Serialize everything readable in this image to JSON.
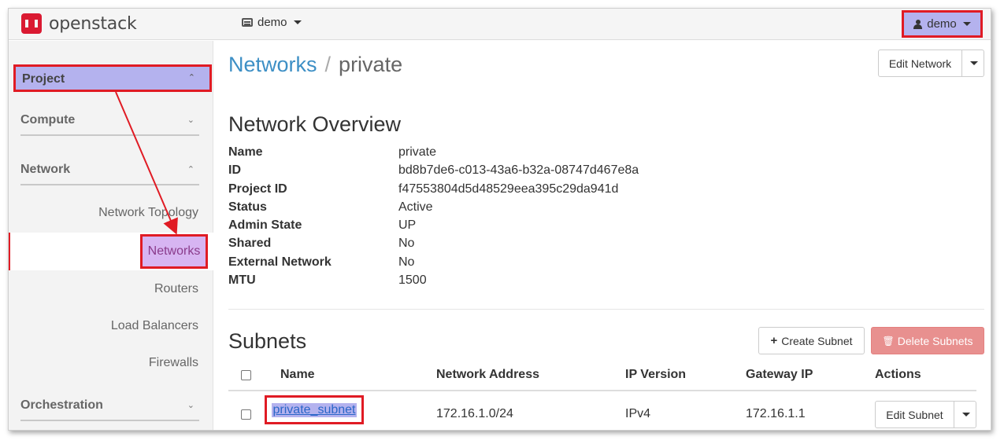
{
  "topbar": {
    "brand": "openstack",
    "project_selector": "demo",
    "user_menu": "demo"
  },
  "sidebar": {
    "project": "Project",
    "compute": "Compute",
    "network": "Network",
    "network_links": [
      "Network Topology",
      "Networks",
      "Routers",
      "Load Balancers",
      "Firewalls"
    ],
    "orchestration": "Orchestration",
    "active_item": "Networks"
  },
  "breadcrumb": {
    "parent": "Networks",
    "separator": "/",
    "current": "private"
  },
  "actions": {
    "edit_network": "Edit Network",
    "create_subnet": "Create Subnet",
    "delete_subnets": "Delete Subnets"
  },
  "overview": {
    "title": "Network Overview",
    "rows": [
      {
        "key": "Name",
        "value": "private"
      },
      {
        "key": "ID",
        "value": "bd8b7de6-c013-43a6-b32a-08747d467e8a"
      },
      {
        "key": "Project ID",
        "value": "f47553804d5d48529eea395c29da941d"
      },
      {
        "key": "Status",
        "value": "Active"
      },
      {
        "key": "Admin State",
        "value": "UP"
      },
      {
        "key": "Shared",
        "value": "No"
      },
      {
        "key": "External Network",
        "value": "No"
      },
      {
        "key": "MTU",
        "value": "1500"
      }
    ]
  },
  "subnets": {
    "title": "Subnets",
    "columns": [
      "Name",
      "Network Address",
      "IP Version",
      "Gateway IP",
      "Actions"
    ],
    "rows": [
      {
        "name": "private_subnet",
        "network_address": "172.16.1.0/24",
        "ip_version": "IPv4",
        "gateway_ip": "172.16.1.1",
        "action": "Edit Subnet"
      }
    ]
  },
  "colors": {
    "highlight_fill": "#b4b2ee",
    "highlight_border": "#e01b24",
    "link_blue": "#3d8fc5",
    "brand_red": "#da1a32",
    "danger_button": "#e8908f"
  }
}
